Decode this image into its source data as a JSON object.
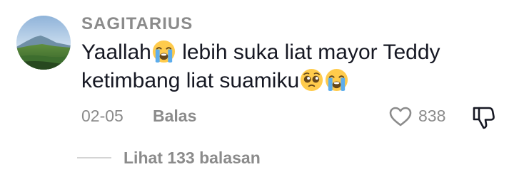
{
  "comment": {
    "username": "SAGITARIUS",
    "text_line1_part1": "Yaallah",
    "text_line1_part2": " lebih suka liat mayor Teddy",
    "text_line2": "ketimbang liat suamiku",
    "emojis": [
      "loudly-crying-face",
      "pleading-face",
      "loudly-crying-face"
    ],
    "date": "02-05",
    "reply_label": "Balas",
    "like_count": "838",
    "view_replies_label": "Lihat 133 balasan"
  },
  "colors": {
    "text_primary": "#161823",
    "text_secondary": "#8b8b8b",
    "divider": "#d4d4d4"
  },
  "icons": {
    "like": "heart-outline-icon",
    "dislike": "thumbs-down-outline-icon"
  }
}
